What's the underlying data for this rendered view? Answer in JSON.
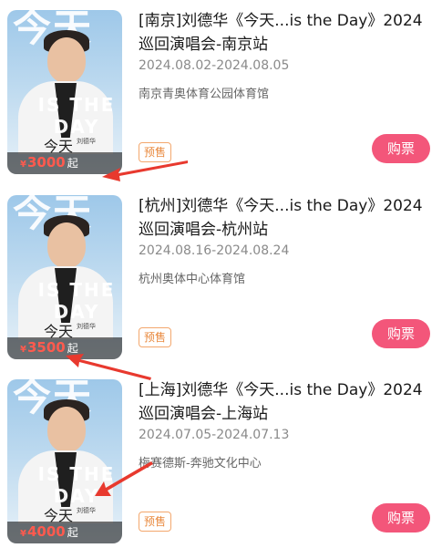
{
  "events": [
    {
      "title": "[南京]刘德华《今天...is the Day》2024巡回演唱会-南京站",
      "date": "2024.08.02-2024.08.05",
      "venue": "南京青奥体育公园体育馆",
      "tag": "预售",
      "buy": "购票",
      "price": "3000",
      "currency": "¥",
      "price_suffix": "起"
    },
    {
      "title": "[杭州]刘德华《今天...is the Day》2024巡回演唱会-杭州站",
      "date": "2024.08.16-2024.08.24",
      "venue": "杭州奥体中心体育馆",
      "tag": "预售",
      "buy": "购票",
      "price": "3500",
      "currency": "¥",
      "price_suffix": "起"
    },
    {
      "title": "[上海]刘德华《今天...is the Day》2024巡回演唱会-上海站",
      "date": "2024.07.05-2024.07.13",
      "venue": "梅赛德斯-奔驰文化中心",
      "tag": "预售",
      "buy": "购票",
      "price": "4000",
      "currency": "¥",
      "price_suffix": "起"
    }
  ],
  "poster": {
    "big_text": "今天",
    "day_text": "IS THE DAY",
    "jt": "今天",
    "mini": "刘德华"
  },
  "colors": {
    "buy_button": "#f3567a",
    "tag_border": "#f3a76d",
    "price": "#ff5a4e",
    "annotation_arrow": "#e8392e"
  }
}
